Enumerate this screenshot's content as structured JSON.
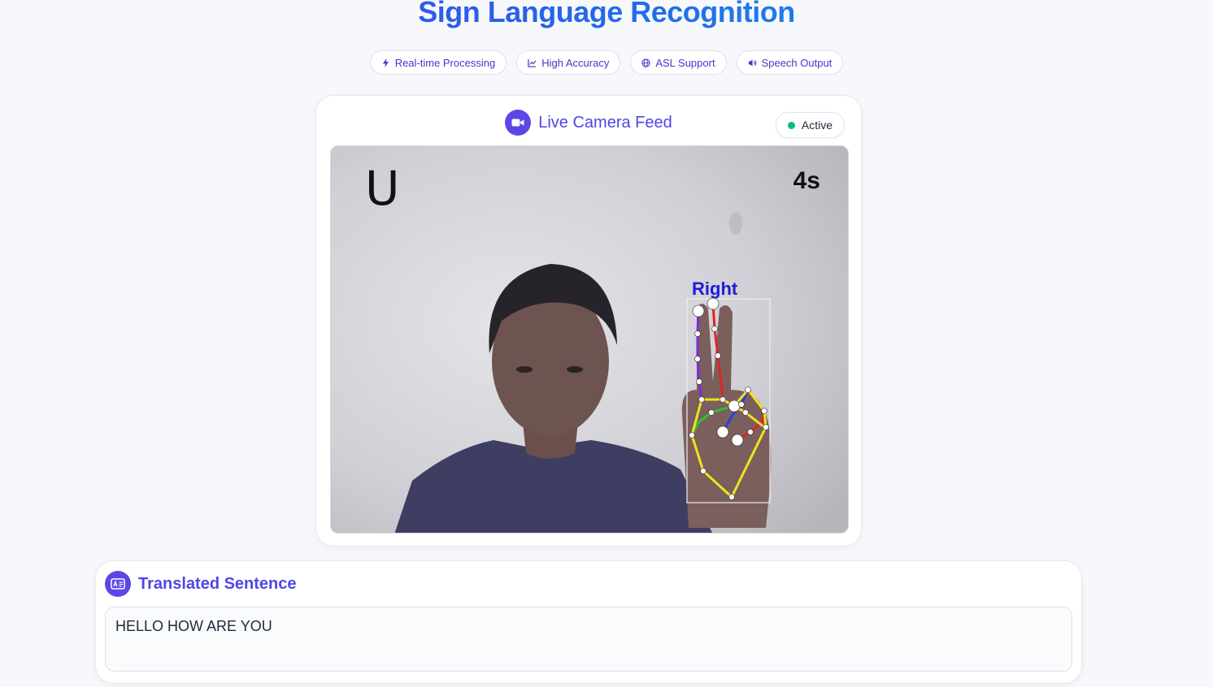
{
  "header": {
    "title": "Sign Language Recognition",
    "features": [
      {
        "icon": "bolt-icon",
        "label": "Real-time Processing"
      },
      {
        "icon": "chart-line-icon",
        "label": "High Accuracy"
      },
      {
        "icon": "globe-icon",
        "label": "ASL Support"
      },
      {
        "icon": "speaker-icon",
        "label": "Speech Output"
      }
    ]
  },
  "camera": {
    "title": "Live Camera Feed",
    "status": "Active",
    "status_color": "#10b981",
    "detected_letter": "U",
    "timer": "4s",
    "hand_label": "Right"
  },
  "sentence": {
    "title": "Translated Sentence",
    "text": "HELLO HOW ARE YOU"
  },
  "colors": {
    "accent": "#4f46e5",
    "icon_bg": "#5b47e6"
  }
}
